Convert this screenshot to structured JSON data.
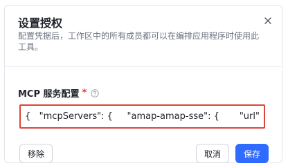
{
  "dialog": {
    "title": "设置授权",
    "description": "配置凭据后，工作区中的所有成员都可以在编排应用程序时使用此工具。",
    "close_icon": "close-icon"
  },
  "form": {
    "field_label": "MCP 服务配置",
    "required_mark": "*",
    "help_icon": "question-circle-icon",
    "config_value": "{   \"mcpServers\": {     \"amap-amap-sse\": {       \"url\": \""
  },
  "buttons": {
    "remove_label": "移除",
    "cancel_label": "取消",
    "save_label": "保存"
  },
  "colors": {
    "primary": "#2f6bff",
    "highlight_border": "#d9453a",
    "required": "#e2362f"
  }
}
